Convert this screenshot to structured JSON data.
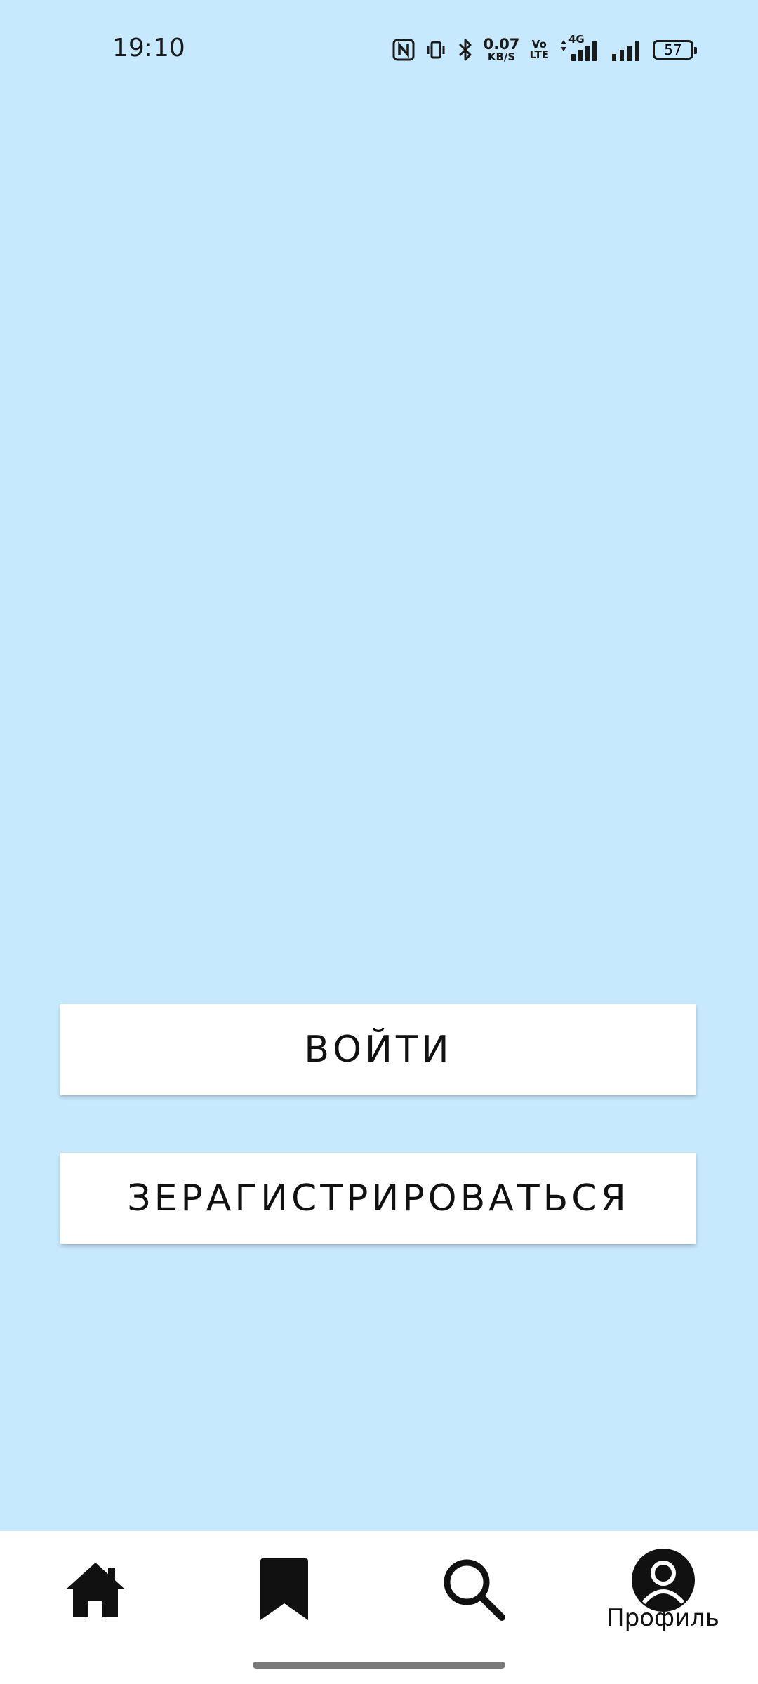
{
  "status_bar": {
    "time": "19:10",
    "net_speed_value": "0.07",
    "net_speed_unit": "KB/S",
    "volte_top": "Vo",
    "volte_bottom": "LTE",
    "network_type": "4G",
    "battery_level": "57",
    "icons": [
      "nfc-icon",
      "vibrate-icon",
      "bluetooth-icon",
      "data-arrows-icon",
      "signal-icon",
      "signal-icon",
      "battery-icon"
    ]
  },
  "buttons": {
    "login_label": "ВОЙТИ",
    "register_label": "ЗЕРАГИСТРИРОВАТЬСЯ"
  },
  "bottom_nav": {
    "items": [
      {
        "id": "home",
        "icon": "home-icon"
      },
      {
        "id": "bookmarks",
        "icon": "bookmark-icon"
      },
      {
        "id": "search",
        "icon": "search-icon"
      },
      {
        "id": "profile",
        "icon": "profile-icon",
        "label": "Профиль"
      }
    ]
  },
  "colors": {
    "background": "#c7e9fd",
    "button_background": "#ffffff",
    "text": "#111111",
    "nav_background": "#ffffff",
    "home_indicator": "#7a7a7a"
  }
}
